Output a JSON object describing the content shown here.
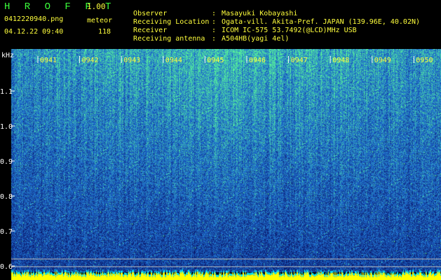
{
  "header": {
    "app_title": "H R O F F T",
    "version": "1.00",
    "file_name": "0412220940.png",
    "date_time": "04.12.22 09:40",
    "mode_label": "meteor",
    "count_value": "118"
  },
  "info": [
    {
      "label": "Observer",
      "value": "Masayuki Kobayashi"
    },
    {
      "label": "Receiving Location",
      "value": "Ogata-vill. Akita-Pref. JAPAN (139.96E, 40.02N)"
    },
    {
      "label": "Receiver",
      "value": "ICOM IC-575 53.7492(@LCD)MHz USB"
    },
    {
      "label": "Receiving antenna",
      "value": "A504HB(yagi 4el)"
    }
  ],
  "spectrogram": {
    "y_unit": "kHz",
    "y_ticks": [
      "1.1",
      "1.0",
      "0.9",
      "0.8",
      "0.7",
      "0.6"
    ],
    "time_labels": [
      "0941",
      "0942",
      "0943",
      "0944",
      "0945",
      "0946",
      "0947",
      "0948",
      "0949",
      "0950"
    ],
    "colors": {
      "background_dark": "#0a1a6a",
      "signal_mid": "#1f6fd6",
      "signal_high": "#2ee0b0",
      "time_label": "#ffff3c",
      "baseline_yellow": "#ffff00",
      "baseline_cyan": "#00e8ff"
    }
  }
}
